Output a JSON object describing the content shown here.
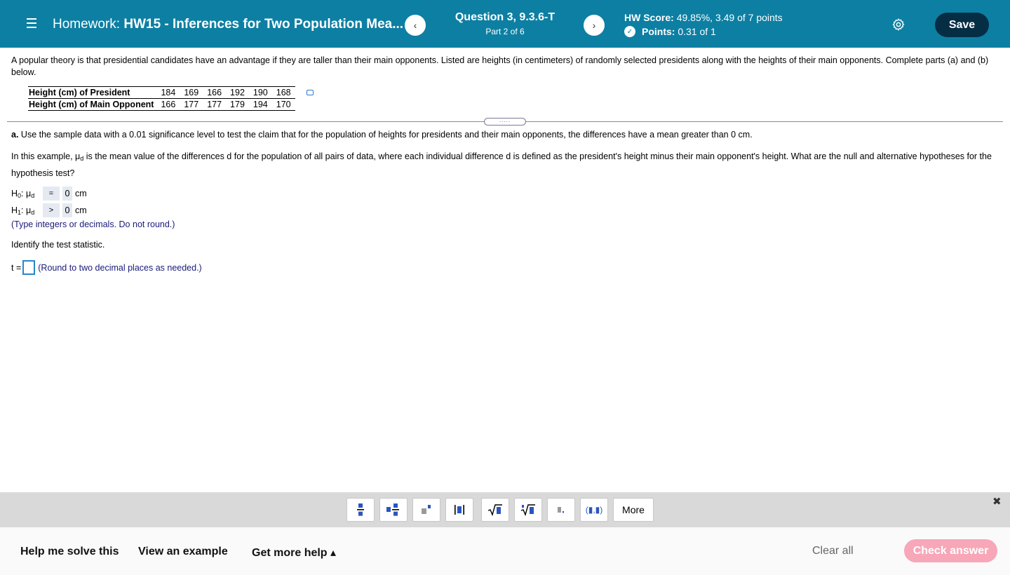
{
  "header": {
    "hw_label": "Homework:",
    "hw_name": "HW15 - Inferences for Two Population Mea...",
    "prev_glyph": "‹",
    "next_glyph": "›",
    "question_title": "Question 3, 9.3.6-T",
    "question_part": "Part 2 of 6",
    "hw_score_label": "HW Score:",
    "hw_score_value": "49.85%, 3.49 of 7 points",
    "points_label": "Points:",
    "points_value": "0.31 of 1",
    "save_label": "Save",
    "colors": {
      "bar": "#0d7fa3",
      "save": "#052e45"
    }
  },
  "problem": {
    "intro": "A popular theory is that presidential candidates have an advantage if they are taller than their main opponents. Listed are heights (in centimeters) of randomly selected presidents along with the heights of their main opponents. Complete parts (a) and (b) below.",
    "table": {
      "rows": [
        {
          "label": "Height (cm) of President",
          "values": [
            "184",
            "169",
            "166",
            "192",
            "190",
            "168"
          ]
        },
        {
          "label": "Height (cm) of Main Opponent",
          "values": [
            "166",
            "177",
            "177",
            "179",
            "194",
            "170"
          ]
        }
      ]
    },
    "expand_glyph": ".....",
    "part_a_label": "a.",
    "part_a_text": "Use the sample data with a 0.01 significance level to test the claim that for the population of heights for presidents and their main opponents, the differences have a mean greater than 0 cm.",
    "explain_before": "In this example, μ",
    "explain_sub": "d",
    "explain_after": " is the mean value of the differences d for the population of all pairs of data, where each individual difference d is defined as the president's height minus their main opponent's height. What are the null and alternative hypotheses for the hypothesis test?",
    "h0": {
      "h": "H",
      "h_sub": "0",
      "mu": ": μ",
      "mu_sub": "d",
      "op": "=",
      "value": "0",
      "unit": "cm"
    },
    "h1": {
      "h": "H",
      "h_sub": "1",
      "mu": ": μ",
      "mu_sub": "d",
      "op": ">",
      "value": "0",
      "unit": "cm"
    },
    "hyp_note": "(Type integers or decimals. Do not round.)",
    "identify": "Identify the test statistic.",
    "t_label": "t =",
    "t_value": "",
    "t_note": "(Round to two decimal places as needed.)"
  },
  "toolbar": {
    "buttons": [
      "fraction",
      "mixed-number",
      "exponent",
      "absolute-value",
      "square-root",
      "nth-root",
      "decimal",
      "interval"
    ],
    "interval_glyph": "(▮,▮)",
    "more_label": "More",
    "close_glyph": "✖"
  },
  "footer": {
    "help_solve": "Help me solve this",
    "view_example": "View an example",
    "get_help": "Get more help ▴",
    "clear_all": "Clear all",
    "check_answer": "Check answer",
    "check_color": "#f7a7b8"
  }
}
